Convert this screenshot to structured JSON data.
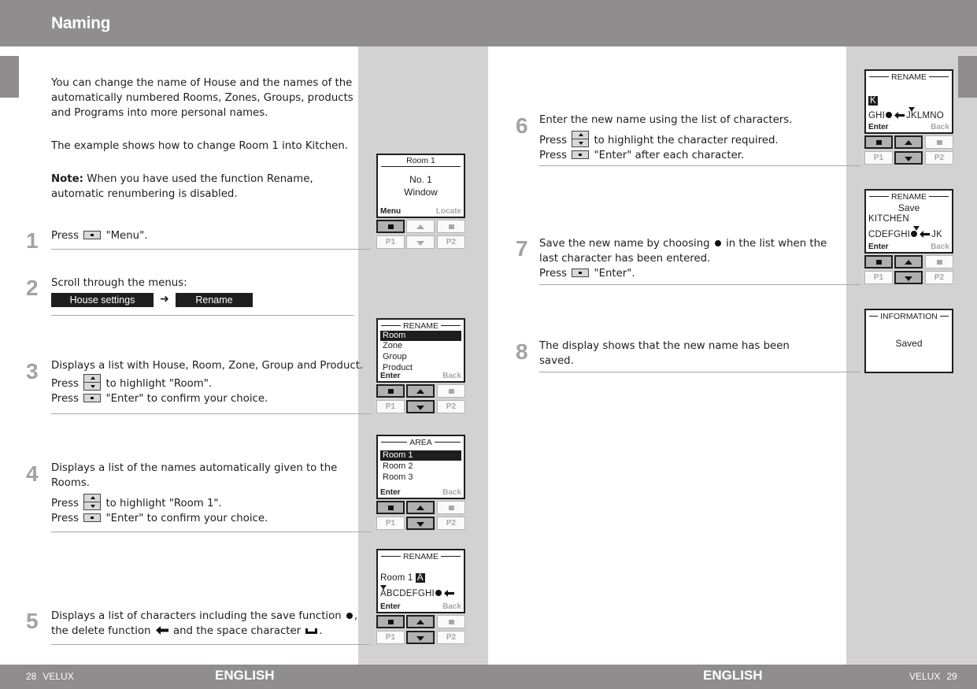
{
  "header": {
    "title": "Naming"
  },
  "footer": {
    "left_page": "28",
    "left_brand": "VELUX",
    "left_lang": "ENGLISH",
    "right_lang": "ENGLISH",
    "right_brand": "VELUX",
    "right_page": "29"
  },
  "intro": {
    "paragraph1": "You can change the name of House and the names of the automatically numbered Rooms, Zones, Groups, products and Programs into more personal names.",
    "paragraph2": "The example shows how to change Room 1 into Kitchen.",
    "note_label": "Note:",
    "note_text": " When you have used the function Rename, automatic renumbering is disabled."
  },
  "steps": [
    {
      "number": "1",
      "parts": [
        "Press",
        "\"Menu\"."
      ]
    },
    {
      "number": "2",
      "text": "Scroll through the menus:",
      "menu_path": [
        "House settings",
        "Rename"
      ]
    },
    {
      "number": "3",
      "line1": "Displays a list with House, Room, Zone, Group and Product.",
      "line2a": "Press",
      "line2b": "to highlight \"Room\".",
      "line3a": "Press",
      "line3b": "\"Enter\" to confirm your choice."
    },
    {
      "number": "4",
      "line1": "Displays a list of the names automatically given to the Rooms.",
      "line2a": "Press",
      "line2b": "to highlight \"Room 1\".",
      "line3a": "Press",
      "line3b": "\"Enter\" to confirm your choice."
    },
    {
      "number": "5",
      "line1a": "Displays a list of characters including the save function",
      "line1b": ",",
      "line2a": "the delete function",
      "line2b": "and the space character",
      "line2c": "."
    },
    {
      "number": "6",
      "line1": "Enter the new name using the list of characters.",
      "line2a": "Press",
      "line2b": "to highlight the character required.",
      "line3a": "Press",
      "line3b": "\"Enter\" after each character."
    },
    {
      "number": "7",
      "line1a": "Save the new name by choosing",
      "line1b": "in the list when the",
      "line2": "last character has been entered.",
      "line3a": "Press",
      "line3b": "\"Enter\"."
    },
    {
      "number": "8",
      "line1": "The display shows that the new name has been",
      "line2": "saved."
    }
  ],
  "displays": {
    "d1": {
      "title": "Room 1",
      "line1": "No. 1",
      "line2": "Window",
      "soft_left": "Menu",
      "soft_right": "Locate"
    },
    "d3": {
      "title": "RENAME",
      "items": [
        "Room",
        "Zone",
        "Group",
        "Product"
      ],
      "selected": 0,
      "soft_left": "Enter",
      "soft_right": "Back"
    },
    "d4": {
      "title": "AREA",
      "items": [
        "Room 1",
        "Room 2",
        "Room 3"
      ],
      "selected": 0,
      "soft_left": "Enter",
      "soft_right": "Back"
    },
    "d5": {
      "title": "RENAME",
      "name": "Room 1",
      "cursor_char": "A",
      "charset_a": "ABCDEFGHI",
      "soft_left": "Enter",
      "soft_right": "Back"
    },
    "d6": {
      "title": "RENAME",
      "cursor_char": "K",
      "charset_a": "GHI",
      "charset_b": "JKLMNO",
      "soft_left": "Enter",
      "soft_right": "Back"
    },
    "d7": {
      "title": "RENAME",
      "save_label": "Save",
      "name": "KITCHEN",
      "charset_a": "CDEFGHI",
      "charset_b": "JK",
      "soft_left": "Enter",
      "soft_right": "Back"
    },
    "d8": {
      "title": "INFORMATION",
      "message": "Saved"
    }
  },
  "keypad": {
    "p1": "P1",
    "p2": "P2"
  }
}
